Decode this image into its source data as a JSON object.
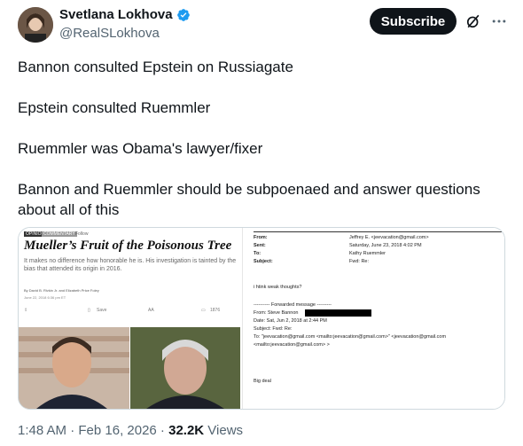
{
  "author": {
    "display_name": "Svetlana Lokhova",
    "handle": "@RealSLokhova",
    "verified": true
  },
  "actions": {
    "subscribe_label": "Subscribe",
    "grok_icon": "grok-icon",
    "more_icon": "more-icon"
  },
  "tweet": {
    "lines": [
      "Bannon consulted Epstein on Russiagate",
      "Epstein consulted Ruemmler",
      "Ruemmler was Obama's lawyer/fixer",
      "Bannon and Ruemmler should be subpoenaed and answer questions about all of this"
    ]
  },
  "media": {
    "article": {
      "tag": "OPINION",
      "section": "COMMENTARY",
      "section2": "Follow",
      "title": "Mueller’s Fruit of the Poisonous Tree",
      "deck": "It makes no difference how honorable he is. His investigation is tainted by the bias that attended its origin in 2016.",
      "byline": "By David B. Rivkin Jr. and Elizabeth Price Foley",
      "date": "June 22, 2018 6:36 pm ET",
      "tools": [
        "Save",
        "AA",
        "1876"
      ]
    },
    "email": {
      "from_label": "From:",
      "from_value": "Jeffrey E. <jeevacation@gmail.com>",
      "sent_label": "Sent:",
      "sent_value": "Saturday, June 23, 2018 4:02 PM",
      "to_label": "To:",
      "to_value": "Kathy Ruemmler",
      "subject_label": "Subject:",
      "subject_value": "Fwd: Re:",
      "body1": "i htink weak  thoughts?",
      "fwd_header": "---------- Forwarded message ---------",
      "fwd_from": "From: Steve Bannon",
      "fwd_date": "Date: Sat, Jun 2­, 2018 at 2:44 PM",
      "fwd_subject": "Subject: Fwd: Re:",
      "fwd_to": "To: \"jeevacation@gmail.com <mailto:jeevacation@gmail.com>\" <jeevacation@gmail.com",
      "fwd_to2": "<mailto:jeevacation@gmail.com> >",
      "body2": "Big deal"
    }
  },
  "meta": {
    "time": "1:48 AM · Feb 16, 2026 · ",
    "views_count": "32.2K",
    "views_label": " Views"
  }
}
